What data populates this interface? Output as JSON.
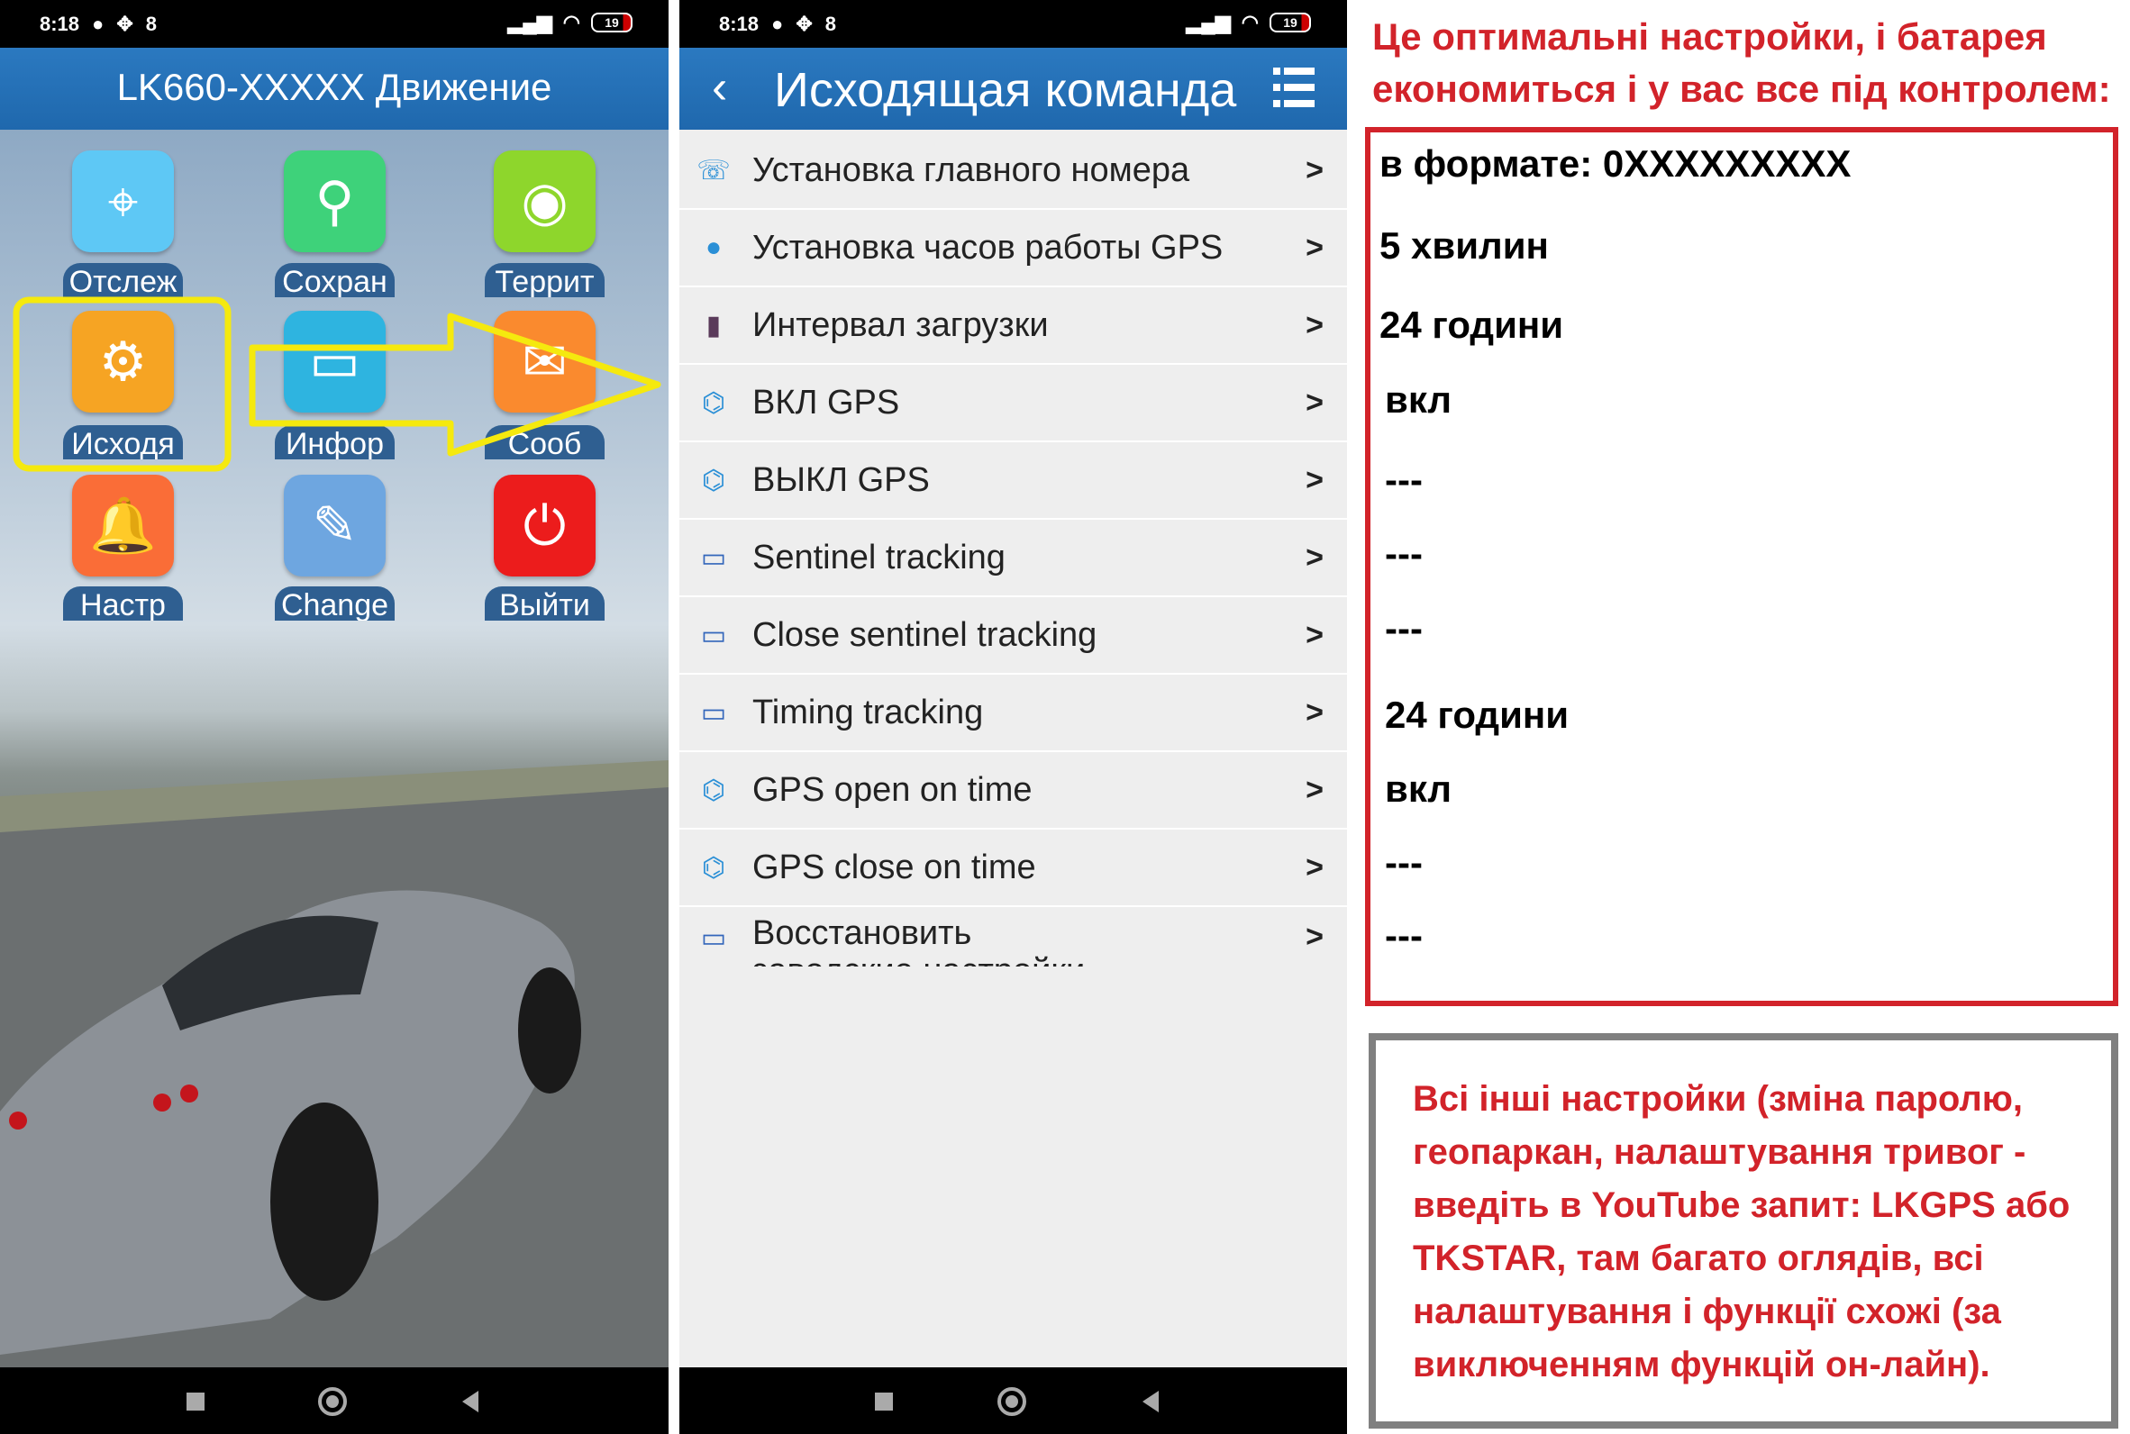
{
  "status_bar": {
    "time": "8:18",
    "notif_count": "8",
    "battery": "19"
  },
  "left_phone": {
    "title": "LK660-XXXXX Движение",
    "tiles": [
      {
        "label": "Отслеж",
        "icon": "crosshair-icon",
        "color": "#5ec8f5"
      },
      {
        "label": "Сохран",
        "icon": "map-pin-icon",
        "color": "#3ed27a"
      },
      {
        "label": "Террит",
        "icon": "target-disc-icon",
        "color": "#8ed62c"
      },
      {
        "label": "Исходя",
        "icon": "gear-icon",
        "color": "#f6a423"
      },
      {
        "label": "Инфор",
        "icon": "laptop-icon",
        "color": "#2eb4e0"
      },
      {
        "label": "Сооб",
        "icon": "envelope-icon",
        "color": "#fa8a2e"
      },
      {
        "label": "Настр",
        "icon": "bell-icon",
        "color": "#fa6d37"
      },
      {
        "label": "Change",
        "icon": "pencil-icon",
        "color": "#6ea6e0"
      },
      {
        "label": "Выйти",
        "icon": "power-icon",
        "color": "#ec1c1c"
      }
    ],
    "highlight_color": "#f5e90e"
  },
  "mid_phone": {
    "title": "Исходящая команда",
    "items": [
      {
        "label": "Установка главного номера",
        "icon": "phone-keypad-icon"
      },
      {
        "label": "Установка часов работы GPS",
        "icon": "globe-icon"
      },
      {
        "label": "Интервал загрузки",
        "icon": "mouse-icon"
      },
      {
        "label": "ВКЛ GPS",
        "icon": "satellite-icon"
      },
      {
        "label": "ВЫКЛ GPS",
        "icon": "satellite-off-icon"
      },
      {
        "label": "Sentinel tracking",
        "icon": "laptop-clock-icon"
      },
      {
        "label": "Close sentinel tracking",
        "icon": "laptop-clock-icon"
      },
      {
        "label": "Timing tracking",
        "icon": "laptop-clock-icon"
      },
      {
        "label": "GPS open on time",
        "icon": "satellite-icon"
      },
      {
        "label": "GPS close on time",
        "icon": "satellite-icon"
      },
      {
        "label": "Восстановить заводские настройки",
        "icon": "laptop-reset-icon"
      }
    ]
  },
  "annotation": {
    "title_line1": "Це оптимальні настройки, і батарея",
    "title_line2": "економиться і у вас все під контролем:",
    "values": [
      "в формате: 0XXXXXXXXX",
      "5 хвилин",
      "24 години",
      "вкл",
      "---",
      "---",
      "---",
      "24 години",
      "вкл",
      "---",
      "---"
    ],
    "note": "Всі інші настройки (зміна паролю, геопаркан, налаштування тривог - введіть в YouTube запит: LKGPS або TKSTAR, там багато оглядів, всі налаштування і функції схожі (за виключенням функцій он-лайн).",
    "red": "#d2232a",
    "gray": "#808080"
  }
}
